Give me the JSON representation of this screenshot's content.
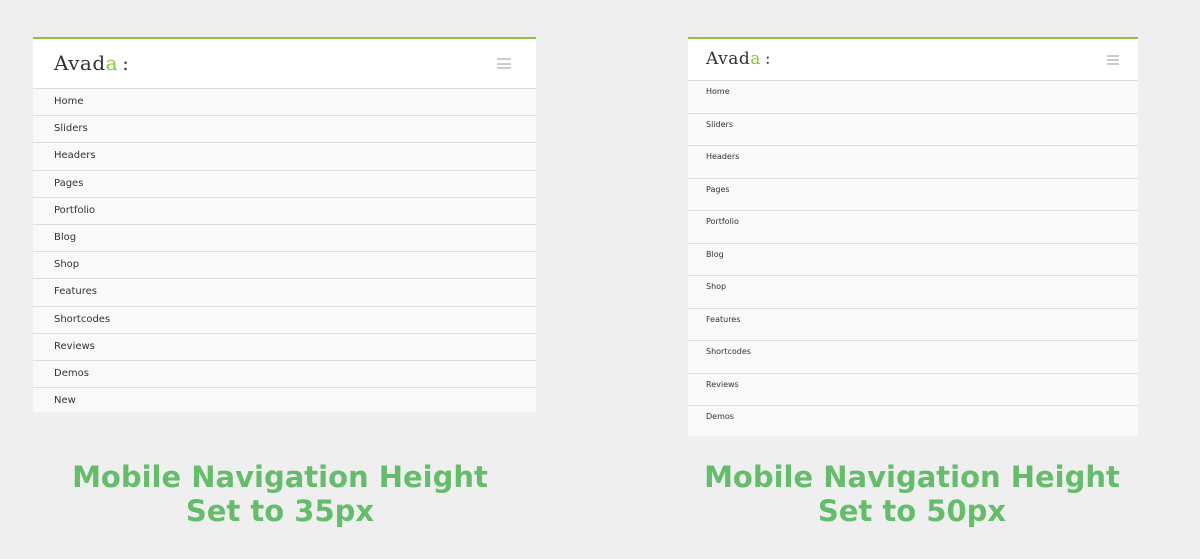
{
  "left": {
    "logo": {
      "text": "Avad",
      "accent": "a",
      "colon": ":"
    },
    "menu_icon": "hamburger-menu-icon",
    "nav_items": [
      "Home",
      "Sliders",
      "Headers",
      "Pages",
      "Portfolio",
      "Blog",
      "Shop",
      "Features",
      "Shortcodes",
      "Reviews",
      "Demos",
      "New"
    ],
    "caption": {
      "line1": "Mobile Navigation Height",
      "line2": "Set to 35px"
    }
  },
  "right": {
    "logo": {
      "text": "Avad",
      "accent": "a",
      "colon": ":"
    },
    "menu_icon": "hamburger-menu-icon",
    "nav_items": [
      "Home",
      "Sliders",
      "Headers",
      "Pages",
      "Portfolio",
      "Blog",
      "Shop",
      "Features",
      "Shortcodes",
      "Reviews",
      "Demos"
    ],
    "caption": {
      "line1": "Mobile Navigation Height",
      "line2": "Set to 50px"
    }
  },
  "colors": {
    "accent": "#8cc63f",
    "caption": "#65bd6b",
    "background": "#efefef"
  }
}
